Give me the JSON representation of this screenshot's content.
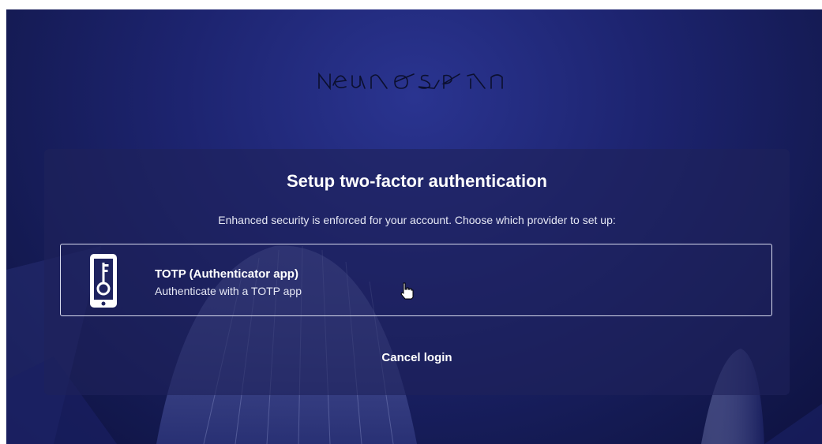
{
  "logo": {
    "text": "NeuroSpin",
    "icon": "stylized-wordmark"
  },
  "dialog": {
    "title": "Setup two-factor authentication",
    "subtitle": "Enhanced security is enforced for your account. Choose which provider to set up:",
    "providers": [
      {
        "name": "TOTP (Authenticator app)",
        "description": "Authenticate with a TOTP app",
        "icon": "phone-key-icon"
      }
    ],
    "cancel_label": "Cancel login"
  },
  "colors": {
    "background": "#1d2470",
    "panel": "#1e225a",
    "text": "#ffffff",
    "border": "#d8dbee"
  }
}
